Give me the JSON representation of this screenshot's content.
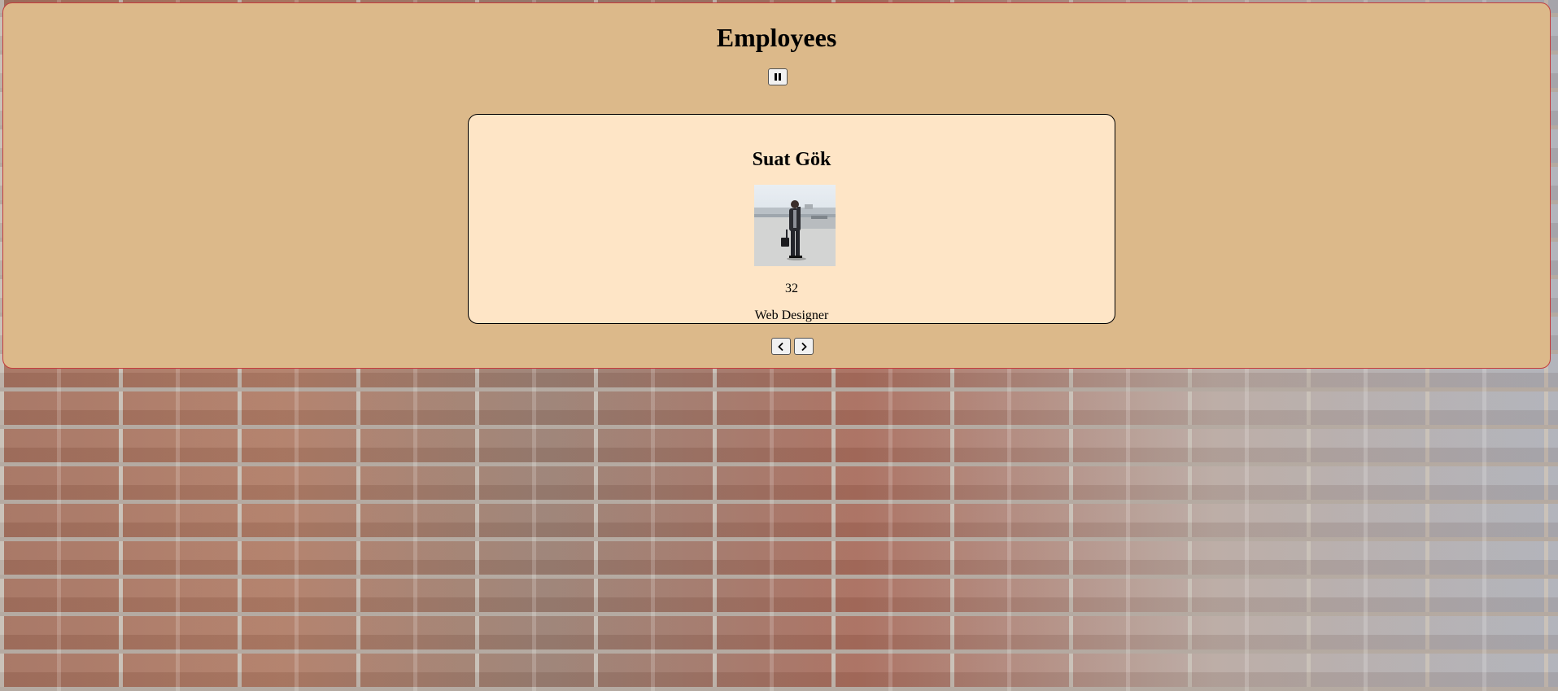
{
  "page": {
    "title": "Employees"
  },
  "controls": {
    "pause_icon": "pause-icon",
    "prev_icon": "chevron-left-icon",
    "next_icon": "chevron-right-icon"
  },
  "employee": {
    "name": "Suat Gök",
    "age": "32",
    "role": "Web Designer",
    "photo_alt": "Suat Gök"
  },
  "colors": {
    "panel_background": "#dcb98a",
    "panel_border": "#c43d3d",
    "card_background": "#fee5c6"
  }
}
